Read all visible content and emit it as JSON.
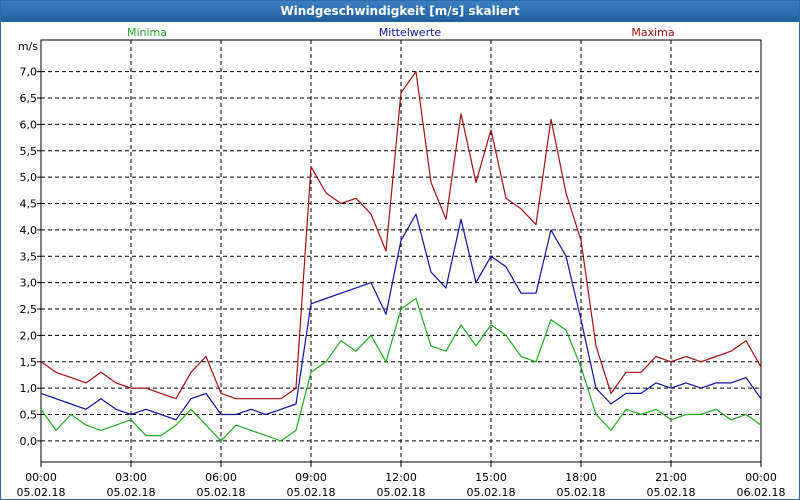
{
  "window": {
    "title": "Windgeschwindigkeit [m/s] skaliert"
  },
  "colors": {
    "min": "#22aa22",
    "mean": "#1010a0",
    "max": "#a01010",
    "axis": "#000000",
    "grid": "#000000"
  },
  "chart_data": {
    "type": "line",
    "title": "Windgeschwindigkeit [m/s] skaliert",
    "ylabel": "m/s",
    "xlabel": "",
    "ylim": [
      -0.4,
      7.6
    ],
    "yticks": [
      0.0,
      0.5,
      1.0,
      1.5,
      2.0,
      2.5,
      3.0,
      3.5,
      4.0,
      4.5,
      5.0,
      5.5,
      6.0,
      6.5,
      7.0
    ],
    "ytick_labels": [
      "0,0",
      "0,5",
      "1,0",
      "1,5",
      "2,0",
      "2,5",
      "3,0",
      "3,5",
      "4,0",
      "4,5",
      "5,0",
      "5,5",
      "6,0",
      "6,5",
      "7,0"
    ],
    "xlim": [
      0,
      24
    ],
    "xticks": [
      0,
      3,
      6,
      9,
      12,
      15,
      18,
      21,
      24
    ],
    "xtick_labels": [
      [
        "00:00",
        "05.02.18"
      ],
      [
        "03:00",
        "05.02.18"
      ],
      [
        "06:00",
        "05.02.18"
      ],
      [
        "09:00",
        "05.02.18"
      ],
      [
        "12:00",
        "05.02.18"
      ],
      [
        "15:00",
        "05.02.18"
      ],
      [
        "18:00",
        "05.02.18"
      ],
      [
        "21:00",
        "05.02.18"
      ],
      [
        "00:00",
        "06.02.18"
      ]
    ],
    "grid": true,
    "legend_position": "top",
    "series": [
      {
        "name": "Minima",
        "color_key": "min",
        "x": [
          0,
          0.5,
          1,
          1.5,
          2,
          2.5,
          3,
          3.5,
          4,
          4.5,
          5,
          5.5,
          6,
          6.5,
          7,
          7.5,
          8,
          8.5,
          9,
          9.5,
          10,
          10.5,
          11,
          11.5,
          12,
          12.5,
          13,
          13.5,
          14,
          14.5,
          15,
          15.5,
          16,
          16.5,
          17,
          17.5,
          18,
          18.5,
          19,
          19.5,
          20,
          20.5,
          21,
          21.5,
          22,
          22.5,
          23,
          23.5,
          24
        ],
        "y": [
          0.6,
          0.2,
          0.5,
          0.3,
          0.2,
          0.3,
          0.4,
          0.1,
          0.1,
          0.3,
          0.6,
          0.3,
          0.0,
          0.3,
          0.2,
          0.1,
          0.0,
          0.2,
          1.3,
          1.5,
          1.9,
          1.7,
          2.0,
          1.5,
          2.5,
          2.7,
          1.8,
          1.7,
          2.2,
          1.8,
          2.2,
          2.0,
          1.6,
          1.5,
          2.3,
          2.1,
          1.4,
          0.5,
          0.2,
          0.6,
          0.5,
          0.6,
          0.4,
          0.5,
          0.5,
          0.6,
          0.4,
          0.5,
          0.3
        ]
      },
      {
        "name": "Mittelwerte",
        "color_key": "mean",
        "x": [
          0,
          0.5,
          1,
          1.5,
          2,
          2.5,
          3,
          3.5,
          4,
          4.5,
          5,
          5.5,
          6,
          6.5,
          7,
          7.5,
          8,
          8.5,
          9,
          9.5,
          10,
          10.5,
          11,
          11.5,
          12,
          12.5,
          13,
          13.5,
          14,
          14.5,
          15,
          15.5,
          16,
          16.5,
          17,
          17.5,
          18,
          18.5,
          19,
          19.5,
          20,
          20.5,
          21,
          21.5,
          22,
          22.5,
          23,
          23.5,
          24
        ],
        "y": [
          0.9,
          0.8,
          0.7,
          0.6,
          0.8,
          0.6,
          0.5,
          0.6,
          0.5,
          0.4,
          0.8,
          0.9,
          0.5,
          0.5,
          0.6,
          0.5,
          0.6,
          0.7,
          2.6,
          2.7,
          2.8,
          2.9,
          3.0,
          2.4,
          3.8,
          4.3,
          3.2,
          2.9,
          4.2,
          3.0,
          3.5,
          3.3,
          2.8,
          2.8,
          4.0,
          3.5,
          2.3,
          1.0,
          0.7,
          0.9,
          0.9,
          1.1,
          1.0,
          1.1,
          1.0,
          1.1,
          1.1,
          1.2,
          0.8
        ]
      },
      {
        "name": "Maxima",
        "color_key": "max",
        "x": [
          0,
          0.5,
          1,
          1.5,
          2,
          2.5,
          3,
          3.5,
          4,
          4.5,
          5,
          5.5,
          6,
          6.5,
          7,
          7.5,
          8,
          8.5,
          9,
          9.5,
          10,
          10.5,
          11,
          11.5,
          12,
          12.5,
          13,
          13.5,
          14,
          14.5,
          15,
          15.5,
          16,
          16.5,
          17,
          17.5,
          18,
          18.5,
          19,
          19.5,
          20,
          20.5,
          21,
          21.5,
          22,
          22.5,
          23,
          23.5,
          24
        ],
        "y": [
          1.5,
          1.3,
          1.2,
          1.1,
          1.3,
          1.1,
          1.0,
          1.0,
          0.9,
          0.8,
          1.3,
          1.6,
          0.9,
          0.8,
          0.8,
          0.8,
          0.8,
          1.0,
          5.2,
          4.7,
          4.5,
          4.6,
          4.3,
          3.6,
          6.6,
          7.0,
          4.9,
          4.2,
          6.2,
          4.9,
          5.9,
          4.6,
          4.4,
          4.1,
          6.1,
          4.7,
          3.8,
          1.8,
          0.9,
          1.3,
          1.3,
          1.6,
          1.5,
          1.6,
          1.5,
          1.6,
          1.7,
          1.9,
          1.4
        ]
      }
    ]
  }
}
